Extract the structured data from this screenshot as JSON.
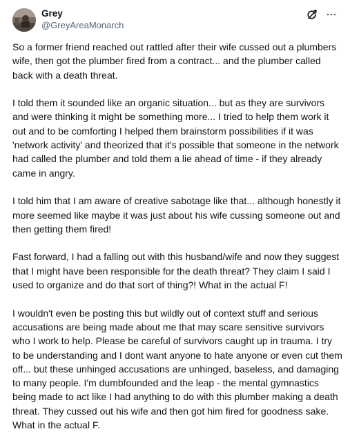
{
  "author": {
    "display_name": "Grey",
    "handle": "@GreyAreaMonarch"
  },
  "icons": {
    "grok": "grok-icon",
    "more": "more-options-icon"
  },
  "post": {
    "paragraphs": [
      "So a former friend reached out rattled after their wife cussed out a plumbers wife, then got the plumber fired from a contract... and the plumber called back with a death threat.",
      "I told them it sounded like an organic situation... but as they are survivors and were thinking it might be something more... I tried to help them work it out and to be comforting I helped them brainstorm possibilities if it was 'network activity' and theorized that it's possible that someone in the network had called the plumber and told them a lie ahead of time - if they already came in angry.",
      "I told him that I am aware of creative sabotage like that... although honestly it more seemed like maybe it was just about his wife cussing someone out and then getting them fired!",
      "Fast forward, I had a falling out with this husband/wife and now they suggest that I might have been responsible for the death threat? They claim I said I used to organize and do that sort of thing?! What in the actual F!",
      "I wouldn't even be posting this but wildly out of context stuff and serious accusations are being made about me that may scare sensitive survivors who I work to help. Please be careful of survivors caught up in trauma. I try to be understanding and I dont want anyone to hate anyone or even cut them off... but these unhinged accusations are unhinged, baseless, and damaging to many people. I'm dumbfounded and the leap - the mental gymnastics being made to act like I had anything to do with this plumber making a death threat. They cussed out his wife and then got him fired for goodness sake. What in the actual F."
    ]
  },
  "colors": {
    "text": "#0f1419",
    "secondary": "#536471"
  }
}
